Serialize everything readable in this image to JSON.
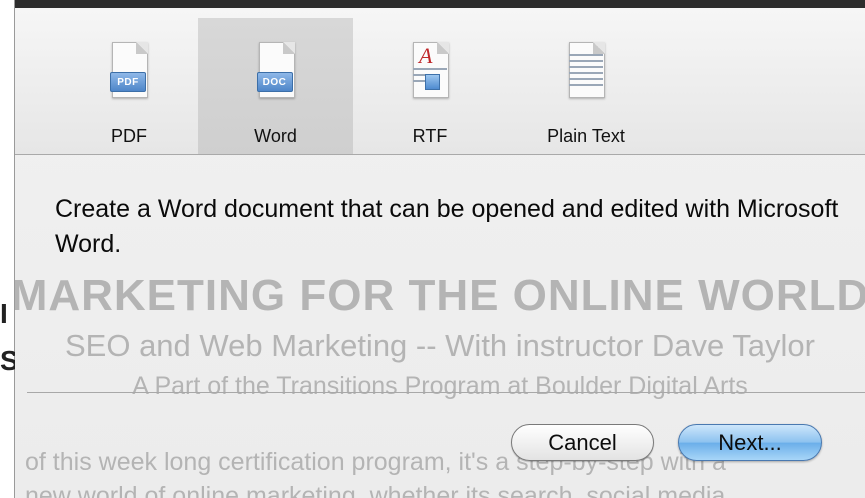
{
  "toolbar": {
    "items": [
      {
        "label": "PDF",
        "badge": "PDF",
        "icon": "pdf-document-icon"
      },
      {
        "label": "Word",
        "badge": "DOC",
        "icon": "word-document-icon",
        "selected": true
      },
      {
        "label": "RTF",
        "badge": "A",
        "icon": "rtf-document-icon"
      },
      {
        "label": "Plain Text",
        "badge": "",
        "icon": "plain-text-document-icon"
      }
    ]
  },
  "description": "Create a Word document that can be opened and edited with Microsoft Word.",
  "background_document": {
    "heading": "MARKETING FOR THE ONLINE WORLD",
    "subheading": "SEO and Web Marketing -- With instructor Dave Taylor",
    "tagline": "A Part of the Transitions Program at Boulder Digital Arts",
    "body_line": "of this week long certification program, it's a step-by-step with a",
    "body_line_2": "new world of online marketing, whether its search, social media,"
  },
  "buttons": {
    "cancel": "Cancel",
    "next": "Next..."
  },
  "colors": {
    "accent": "#6aaee9",
    "selected_tab": "#d3d3d3"
  }
}
